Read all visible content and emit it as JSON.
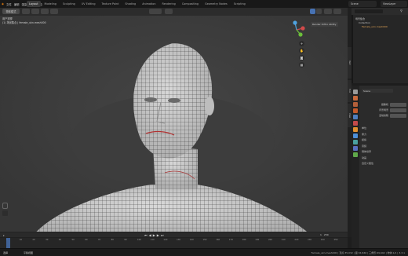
{
  "topbar": {
    "menu": [
      "文件",
      "编辑",
      "渲染",
      "窗口",
      "帮助"
    ],
    "tabs": [
      "Layout",
      "Modeling",
      "Sculpting",
      "UV Editing",
      "Texture Paint",
      "Shading",
      "Animation",
      "Rendering",
      "Compositing",
      "Geometry Nodes",
      "Scripting"
    ],
    "active_tab": "Layout",
    "scene_label": "Scene",
    "view_layer_label": "ViewLayer"
  },
  "viewport": {
    "header_mode": "物体模式",
    "view_label": "用户透视",
    "collection_label": "(1) 场景集合 | female_ukn.mesh000",
    "overlay_tag": "Render Ortho Ability",
    "gizmo_icons": [
      "zoom-icon",
      "hand-icon",
      "camera-icon",
      "grid-icon"
    ]
  },
  "outliner": {
    "title": "场景集合",
    "items": [
      "Collection",
      "Female_ukn.mesh000"
    ]
  },
  "properties": {
    "section_title": "Scene",
    "rows": [
      {
        "label": "摄像机",
        "value": ""
      },
      {
        "label": "背景场景",
        "value": ""
      },
      {
        "label": "活动剪辑",
        "value": ""
      }
    ],
    "subsections": [
      "单位",
      "重力",
      "模拟",
      "音频",
      "刚体世界",
      "动画",
      "自定义属性"
    ]
  },
  "timeline": {
    "frame_start": "1",
    "frame_end": "250",
    "current": "1",
    "ticks": [
      "0",
      "10",
      "20",
      "30",
      "40",
      "50",
      "60",
      "70",
      "80",
      "90",
      "100",
      "110",
      "120",
      "130",
      "140",
      "150",
      "160",
      "170",
      "180",
      "190",
      "200",
      "210",
      "220",
      "230",
      "240",
      "250"
    ]
  },
  "statusbar": {
    "left": "选择",
    "middle": "平移视图",
    "right": "Female_ukn.mesh000 | 顶点:35,032 | 面:34,846 | 三角形:69,692 | 物体:1/1 | 3.3.1"
  },
  "colors": {
    "accent": "#4772b3",
    "mesh": "#cfcfcf",
    "grid": "#414141"
  }
}
